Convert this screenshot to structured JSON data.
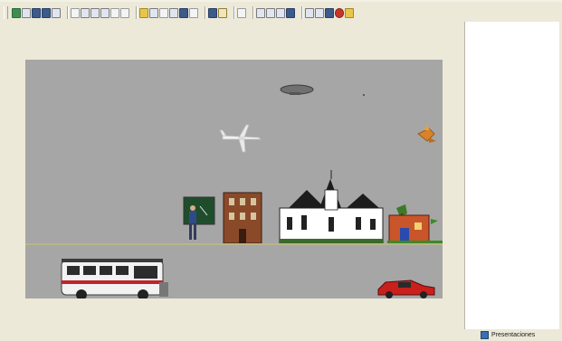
{
  "toolbar": {
    "buttons": [
      "new-icon",
      "open-icon",
      "save-icon",
      "print-icon",
      "save-as-icon",
      "cut-icon",
      "undo-icon",
      "redo-icon",
      "copy-icon",
      "paste-icon",
      "delete-icon",
      "hand-icon",
      "image-icon",
      "frame-icon",
      "sound-icon",
      "music-icon",
      "text-icon",
      "book-icon",
      "pencil-icon",
      "pointer-icon",
      "zoom-in-icon",
      "zoom-out-icon",
      "rotate-icon",
      "mirror-icon",
      "cursor-move-icon",
      "play-icon",
      "record-icon",
      "stop-icon",
      "help-icon"
    ]
  },
  "scene": {
    "objects": [
      "airship",
      "airplane",
      "bird",
      "chalkboard-teacher",
      "brick-building",
      "church",
      "house-with-tree",
      "bus",
      "red-car"
    ]
  },
  "right_panel": {
    "tab_label": "Presentaciones"
  },
  "colors": {
    "background": "#ece9d8",
    "stage": "#a6a6a6",
    "panel": "#ffffff"
  }
}
